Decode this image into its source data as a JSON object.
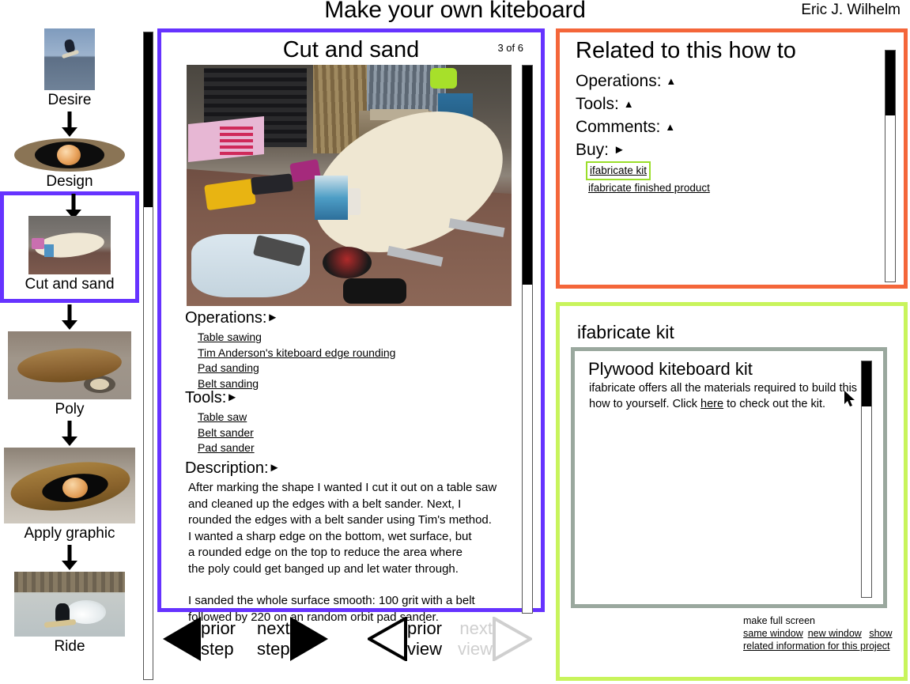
{
  "header": {
    "title": "Make your own kiteboard",
    "author": "Eric J. Wilhelm"
  },
  "sidebar": {
    "steps": [
      {
        "label": "Desire",
        "current": false,
        "thumb": "kiteboarder-jumping-photo"
      },
      {
        "label": "Design",
        "current": false,
        "thumb": "board-graphic-oval-photo"
      },
      {
        "label": "Cut and sand",
        "current": true,
        "thumb": "board-blank-on-bench-photo"
      },
      {
        "label": "Poly",
        "current": false,
        "thumb": "wooden-board-on-sawhorse-photo"
      },
      {
        "label": "Apply graphic",
        "current": false,
        "thumb": "board-with-planet-graphic-photo"
      },
      {
        "label": "Ride",
        "current": false,
        "thumb": "rider-on-water-photo"
      }
    ],
    "scrollbar": {
      "thumb_top_pct": 0,
      "thumb_height_pct": 27
    }
  },
  "main": {
    "title": "Cut and sand",
    "page_counter": "3 of 6",
    "photo": "workshop-bench-with-kiteboard-blank-and-tools",
    "sections": {
      "operations": {
        "label": "Operations:",
        "marker": "►",
        "links": [
          "Table sawing",
          "Tim Anderson's kiteboard edge rounding",
          "Pad sanding",
          "Belt sanding"
        ]
      },
      "tools": {
        "label": "Tools:",
        "marker": "►",
        "links": [
          "Table saw",
          "Belt sander",
          "Pad sander"
        ]
      },
      "description": {
        "label": "Description:",
        "marker": "►",
        "paragraphs": [
          "After marking the shape I wanted I cut it out on a table saw\nand cleaned up the edges with a belt sander.  Next, I\nrounded the edges with a belt sander using Tim's method.\nI wanted a sharp edge on the bottom, wet surface, but\na rounded edge on the top to reduce the area where\nthe poly could get banged up and let water through.",
          "I sanded the whole surface smooth:  100 grit with a belt\nfollowed by 220 on an random orbit pad  sander."
        ]
      }
    },
    "scrollbar": {
      "thumb_top_pct": 0,
      "thumb_height_pct": 40
    }
  },
  "nav": {
    "prior_step": {
      "line1": "prior",
      "line2": "step",
      "state": "enabled",
      "icon": "triangle-left-solid-icon"
    },
    "next_step": {
      "line1": "next",
      "line2": "step",
      "state": "enabled",
      "icon": "triangle-right-solid-icon"
    },
    "prior_view": {
      "line1": "prior",
      "line2": "view",
      "state": "enabled",
      "icon": "triangle-left-outline-icon"
    },
    "next_view": {
      "line1": "next",
      "line2": "view",
      "state": "disabled",
      "icon": "triangle-right-outline-icon"
    }
  },
  "related": {
    "title": "Related to this how to",
    "rows": [
      {
        "label": "Operations:",
        "marker": "▲"
      },
      {
        "label": "Tools:",
        "marker": "▲"
      },
      {
        "label": "Comments:",
        "marker": "▲"
      },
      {
        "label": "Buy:",
        "marker": "►"
      }
    ],
    "buy_links": [
      {
        "text": "ifabricate kit",
        "selected": true
      },
      {
        "text": "ifabricate finished product",
        "selected": false
      }
    ],
    "scrollbar": {
      "thumb_top_pct": 0,
      "thumb_height_pct": 28
    }
  },
  "kit": {
    "title": "ifabricate kit",
    "product_title": "Plywood kiteboard kit",
    "product_body_before": "ifabricate offers all the materials required to build this how to yourself.  Click ",
    "product_body_link": "here",
    "product_body_after": " to check out the kit.",
    "scrollbar": {
      "thumb_top_pct": 0,
      "thumb_height_pct": 19
    },
    "footer": {
      "full_screen_label": "make full screen",
      "same_window": "same window",
      "new_window": "new window",
      "show_related": "show related information for this project"
    }
  },
  "colors": {
    "main_border": "#6633ff",
    "related_border": "#f4663a",
    "kit_border": "#c8f45c",
    "kit_inner_border": "#9aa89e",
    "selected_link_outline": "#9ade2a",
    "disabled_text": "#cfcfcf"
  }
}
